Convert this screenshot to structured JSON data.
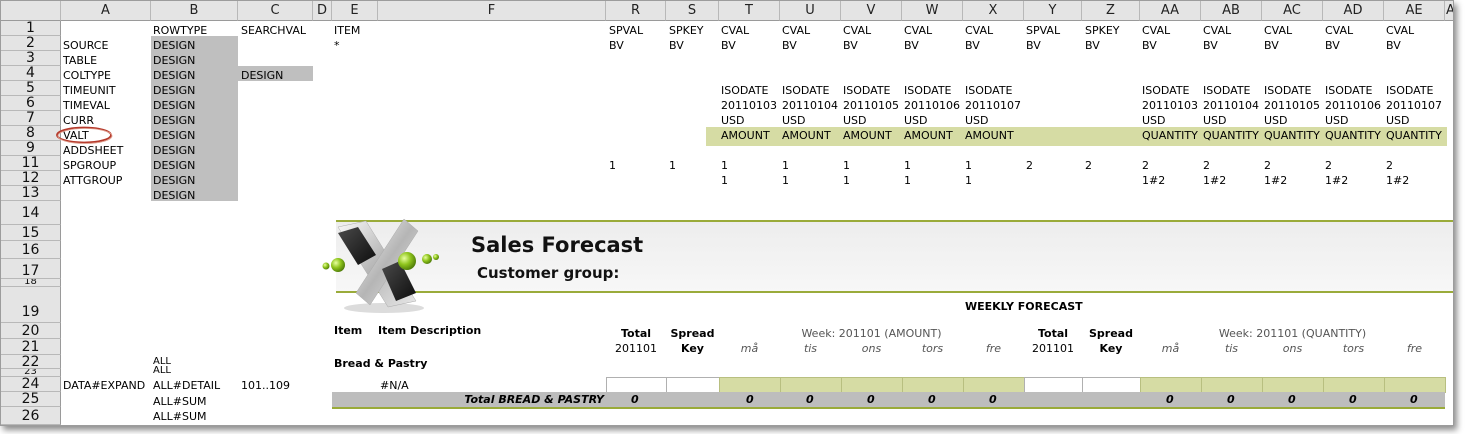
{
  "columns": [
    "A",
    "B",
    "C",
    "D",
    "E",
    "F",
    "R",
    "S",
    "T",
    "U",
    "V",
    "W",
    "X",
    "Y",
    "Z",
    "AA",
    "AB",
    "AC",
    "AD",
    "AE",
    "A"
  ],
  "rows": [
    "1",
    "2",
    "3",
    "4",
    "5",
    "6",
    "7",
    "8",
    "9",
    "11",
    "12",
    "13",
    "14",
    "15",
    "16",
    "17",
    "18",
    "19",
    "20",
    "21",
    "22",
    "23",
    "24",
    "25",
    "26"
  ],
  "row1": {
    "rowtype": "ROWTYPE",
    "searchval": "SEARCHVAL",
    "item": "ITEM",
    "r": "SPVAL",
    "s": "SPKEY",
    "t": "CVAL",
    "u": "CVAL",
    "v": "CVAL",
    "w": "CVAL",
    "x": "CVAL",
    "y": "SPVAL",
    "z": "SPKEY",
    "aa": "CVAL",
    "ab": "CVAL",
    "ac": "CVAL",
    "ad": "CVAL",
    "ae": "CVAL"
  },
  "row2": {
    "a": "SOURCE",
    "b": "DESIGN",
    "e": "*",
    "bv": "BV"
  },
  "row3": {
    "a": "TABLE",
    "b": "DESIGN"
  },
  "row4": {
    "a": "COLTYPE",
    "b": "DESIGN",
    "c": "DESIGN"
  },
  "row5": {
    "a": "TIMEUNIT",
    "b": "DESIGN",
    "iso": "ISODATE"
  },
  "row6": {
    "a": "TIMEVAL",
    "b": "DESIGN",
    "dates": [
      "20110103",
      "20110104",
      "20110105",
      "20110106",
      "20110107"
    ]
  },
  "row7": {
    "a": "CURR",
    "b": "DESIGN",
    "usd": "USD"
  },
  "row8": {
    "a": "VALT",
    "b": "DESIGN",
    "amount": "AMOUNT",
    "quantity": "QUANTITY"
  },
  "row9": {
    "a": "ADDSHEET",
    "b": "DESIGN"
  },
  "row11": {
    "a": "SPGROUP",
    "b": "DESIGN",
    "v1": "1",
    "v2": "2"
  },
  "row12": {
    "a": "ATTGROUP",
    "b": "DESIGN",
    "v1": "1",
    "v2": "1#2"
  },
  "row13": {
    "b": "DESIGN"
  },
  "report": {
    "title": "Sales Forecast",
    "subtitle": "Customer group:",
    "weekly": "WEEKLY FORECAST",
    "item": "Item",
    "item_desc": "Item Description",
    "total": "Total",
    "total_period": "201101",
    "spread": "Spread",
    "key": "Key",
    "week_amount": "Week: 201101 (AMOUNT)",
    "week_quantity": "Week: 201101 (QUANTITY)",
    "days": [
      "må",
      "tis",
      "ons",
      "tors",
      "fre"
    ],
    "group": "Bread & Pastry",
    "na": "#N/A",
    "total_row": "Total BREAD & PASTRY",
    "zero": "0"
  },
  "lower_a": {
    "all1": "ALL",
    "all2": "ALL",
    "expand": "DATA#EXPAND",
    "detail": "ALL#DETAIL",
    "range": "101..109",
    "sum1": "ALL#SUM",
    "sum2": "ALL#SUM"
  },
  "colors": {
    "gray": "#bfbfbf",
    "green": "#d6dca4",
    "olive": "#9aab3a"
  }
}
